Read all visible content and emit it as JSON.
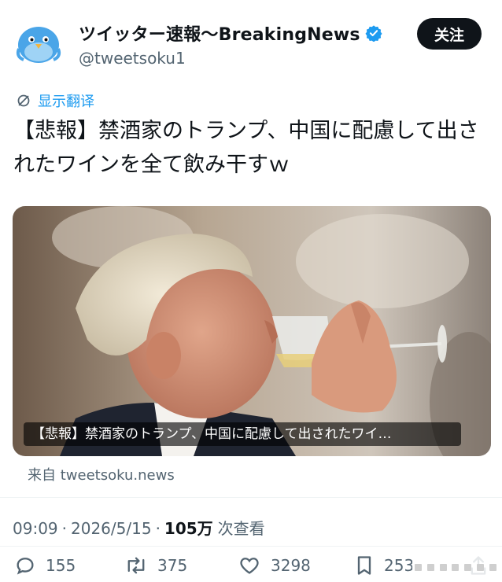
{
  "author": {
    "display_name": "ツイッター速報〜BreakingNews",
    "handle": "@tweetsoku1",
    "avatar_icon": "blue-bird-icon",
    "verified_icon": "verified-badge-icon",
    "verified_color": "#1d9bf0"
  },
  "follow_button": {
    "label": "关注"
  },
  "translate": {
    "label": "显示翻译",
    "icon": "translate-icon"
  },
  "tweet": {
    "text": "【悲報】禁酒家のトランプ、中国に配慮して出されたワインを全て飲み干すｗ"
  },
  "media": {
    "caption": "【悲報】禁酒家のトランプ、中国に配慮して出されたワイ…",
    "source_prefix": "来自",
    "source_domain": "tweetsoku.news"
  },
  "meta": {
    "time": "09:09",
    "date": "2026/5/15",
    "views_count": "105万",
    "views_label": "次查看",
    "separator": "·"
  },
  "actions": {
    "replies": "155",
    "retweets": "375",
    "likes": "3298",
    "bookmarks": "253"
  },
  "colors": {
    "accent": "#1d9bf0",
    "text_primary": "#0f1419",
    "text_secondary": "#536471"
  }
}
